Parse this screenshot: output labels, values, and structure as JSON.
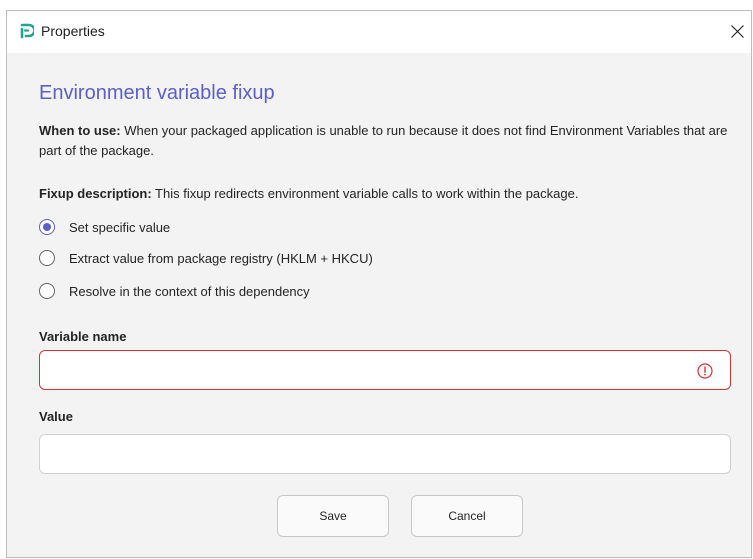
{
  "window": {
    "title": "Properties",
    "app_icon": "app-logo-icon",
    "close_icon": "close-icon"
  },
  "heading": "Environment variable fixup",
  "when_to_use": {
    "label": "When to use:",
    "text": " When your packaged application is unable to run because it does not find Environment Variables that are part of the package."
  },
  "fixup_description": {
    "label": "Fixup description:",
    "text": " This fixup redirects environment variable calls to work within the package."
  },
  "options": [
    {
      "label": "Set specific value",
      "checked": true
    },
    {
      "label": "Extract value from package registry (HKLM + HKCU)",
      "checked": false
    },
    {
      "label": "Resolve in the context of this dependency",
      "checked": false
    }
  ],
  "variable_name": {
    "label": "Variable name",
    "value": "",
    "placeholder": "",
    "error_icon": "error-circle-icon"
  },
  "value_field": {
    "label": "Value",
    "value": "",
    "placeholder": ""
  },
  "buttons": {
    "save": "Save",
    "cancel": "Cancel"
  },
  "colors": {
    "accent": "#5b5fc7",
    "error": "#d13438",
    "background": "#f3f3f3"
  }
}
